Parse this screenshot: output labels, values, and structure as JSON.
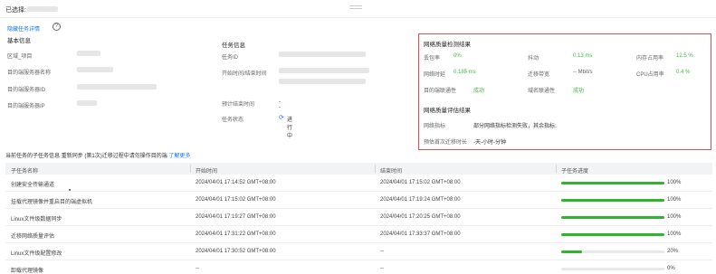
{
  "header": {
    "selected_label": "已选择:"
  },
  "toggle": {
    "hide_details": "隐藏任务详情"
  },
  "basic": {
    "title": "基本信息",
    "rows": [
      {
        "label": "区域_项目"
      },
      {
        "label": "目的端服务器名称"
      },
      {
        "label": "目的端服务器ID"
      },
      {
        "label": "目的端服务器IP"
      }
    ]
  },
  "task": {
    "title": "任务信息",
    "rows": [
      {
        "label": "任务ID"
      },
      {
        "label": "开始时间/结束时间"
      },
      {
        "label": "预计结束时间",
        "value": "--"
      },
      {
        "label": "任务状态",
        "value": "进行中"
      }
    ]
  },
  "network": {
    "title": "网络质量检测结果",
    "metrics": [
      {
        "label": "丢包率",
        "value": "0%"
      },
      {
        "label": "抖动",
        "value": "0.13 ms"
      },
      {
        "label": "内存占用率",
        "value": "12.5 %"
      },
      {
        "label": "网络时延",
        "value": "0.185 ms"
      },
      {
        "label": "迁移带宽",
        "value": "-- Mbit/s"
      },
      {
        "label": "CPU占用率",
        "value": "0.4 %"
      },
      {
        "label": "目的端联通性",
        "value": "成功"
      },
      {
        "label": "域名联通性",
        "value": "成功"
      }
    ]
  },
  "evaluation": {
    "title": "网络质量评估结果",
    "rows": [
      {
        "label": "网络指标",
        "value": "部分网络指标检测失败，其余指标:"
      },
      {
        "label": "预估首次迁移时长",
        "value": "-天-小时-分钟"
      }
    ]
  },
  "subtasks": {
    "title": "当前任务的子任务信息",
    "notice": "重新同步 (第1次)迁移过程中请勿操作目的端",
    "learn_more": "了解更多",
    "columns": [
      "子任务名称",
      "开始时间",
      "结束时间",
      "子任务进度"
    ],
    "rows": [
      {
        "name": "创建安全传输通道",
        "start": "2024/04/01 17:14:52 GMT+08:00",
        "end": "2024/04/01 17:15:02 GMT+08:00",
        "progress": 100,
        "progress_label": "100%"
      },
      {
        "name": "挂载代理镜像并重启目的端虚拟机",
        "start": "2024/04/01 17:15:02 GMT+08:00",
        "end": "2024/04/01 17:19:24 GMT+08:00",
        "progress": 100,
        "progress_label": "100%"
      },
      {
        "name": "Linux文件级数据同步",
        "start": "2024/04/01 17:19:27 GMT+08:00",
        "end": "2024/04/01 17:20:25 GMT+08:00",
        "progress": 100,
        "progress_label": "100%"
      },
      {
        "name": "迁移网络质量评估",
        "start": "2024/04/01 17:31:22 GMT+08:00",
        "end": "2024/04/01 17:33:37 GMT+08:00",
        "progress": 100,
        "progress_label": "100%"
      },
      {
        "name": "Linux文件级配置修改",
        "start": "2024/04/01 17:30:52 GMT+08:00",
        "end": "--",
        "progress": 20,
        "progress_label": "20%"
      },
      {
        "name": "卸载代理镜像",
        "start": "--",
        "end": "--",
        "progress": 0,
        "progress_label": "0%"
      }
    ]
  },
  "colors": {
    "accent": "#1677ff",
    "success": "#2db52d",
    "alert_border": "#e84a4a"
  }
}
